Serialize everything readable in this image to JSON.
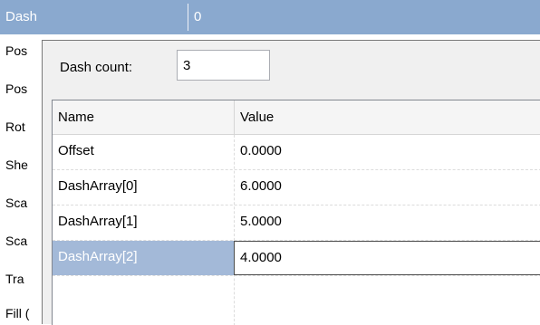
{
  "property_grid": {
    "header": {
      "name": "Dash",
      "value": "0"
    },
    "background_items": [
      "Pos",
      "Pos",
      "Rot",
      "She",
      "Sca",
      "Sca",
      "Tra",
      "Fill ("
    ]
  },
  "dash_editor": {
    "count_label": "Dash count:",
    "count_value": "3",
    "columns": {
      "name": "Name",
      "value": "Value"
    },
    "rows": [
      {
        "name": "Offset",
        "value": "0.0000"
      },
      {
        "name": "DashArray[0]",
        "value": "6.0000"
      },
      {
        "name": "DashArray[1]",
        "value": "5.0000"
      },
      {
        "name": "DashArray[2]",
        "value": "4.0000",
        "selected": true
      }
    ]
  },
  "colors": {
    "header_bg": "#8aa9cf",
    "selection_bg": "#a3b9d8"
  }
}
